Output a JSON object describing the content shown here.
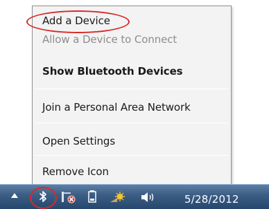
{
  "menu": {
    "items": [
      {
        "label": "Add a Device"
      },
      {
        "label": "Allow a Device to Connect"
      },
      {
        "label": "Show Bluetooth Devices"
      },
      {
        "label": "Join a Personal Area Network"
      },
      {
        "label": "Open Settings"
      },
      {
        "label": "Remove Icon"
      }
    ]
  },
  "taskbar": {
    "tray_icons": [
      "up-arrow-icon",
      "bluetooth-icon",
      "network-error-icon",
      "battery-icon",
      "action-center-icon",
      "volume-icon"
    ],
    "clock": "5/28/2012"
  },
  "colors": {
    "highlight_circle": "#d62a2a",
    "taskbar": "#3d5f86",
    "menu_bg": "#f3f3f3"
  }
}
